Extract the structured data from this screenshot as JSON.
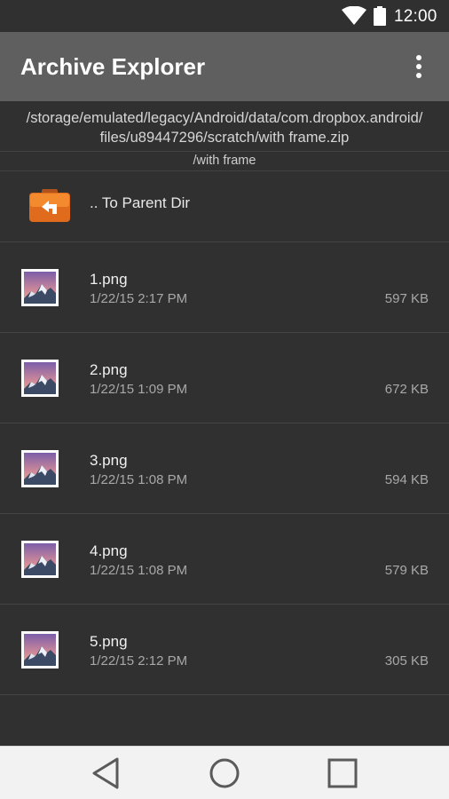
{
  "status_bar": {
    "time": "12:00",
    "icons": [
      "wifi-icon",
      "battery-icon"
    ]
  },
  "app_bar": {
    "title": "Archive Explorer",
    "menu_icon": "overflow-menu-icon"
  },
  "path": {
    "full": "/storage/emulated/legacy/Android/data/com.dropbox.android/\nfiles/u89447296/scratch/with frame.zip",
    "line1": "/storage/emulated/legacy/Android/data/com.dropbox.android/",
    "line2": "files/u89447296/scratch/with frame.zip",
    "sub": "/with frame"
  },
  "parent_dir": {
    "label": ".. To Parent Dir",
    "icon": "folder-up-icon"
  },
  "files": [
    {
      "name": "1.png",
      "date": "1/22/15 2:17 PM",
      "size": "597 KB",
      "icon": "image-thumbnail-icon"
    },
    {
      "name": "2.png",
      "date": "1/22/15 1:09 PM",
      "size": "672 KB",
      "icon": "image-thumbnail-icon"
    },
    {
      "name": "3.png",
      "date": "1/22/15 1:08 PM",
      "size": "594 KB",
      "icon": "image-thumbnail-icon"
    },
    {
      "name": "4.png",
      "date": "1/22/15 1:08 PM",
      "size": "579 KB",
      "icon": "image-thumbnail-icon"
    },
    {
      "name": "5.png",
      "date": "1/22/15 2:12 PM",
      "size": "305 KB",
      "icon": "image-thumbnail-icon"
    }
  ],
  "nav_bar": {
    "icons": [
      "back-icon",
      "home-icon",
      "recents-icon"
    ]
  },
  "colors": {
    "background": "#303030",
    "app_bar": "#5f5f5f",
    "folder_orange": "#f07b1f",
    "nav_bar": "#f2f2f2"
  }
}
